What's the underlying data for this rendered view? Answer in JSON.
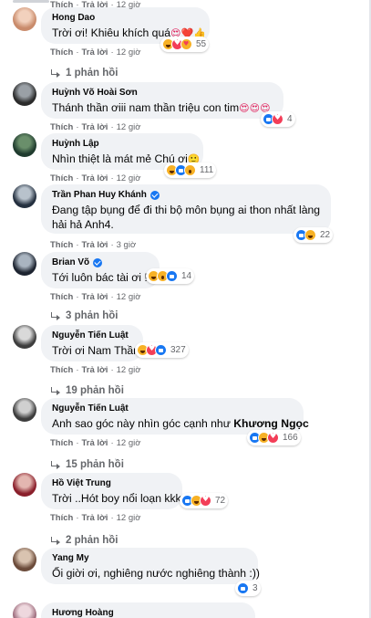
{
  "colors": {
    "bubble_bg": "#f0f2f5",
    "secondary_text": "#65676b",
    "verified_blue": "#1877f2",
    "love_red": "#f33e58",
    "haha_yellow": "#f7b125"
  },
  "action_labels": {
    "like": "Thích",
    "reply": "Trả lời",
    "separator": "·"
  },
  "comments": [
    {
      "author": "Hong Dao",
      "verified": false,
      "text": "Trời ơi! Khiêu khích quá",
      "emoji_suffix": "😍❤️👍",
      "time": "12 giờ",
      "reactions": [
        "haha",
        "love",
        "care"
      ],
      "reaction_count": "55",
      "replies": "1 phản hồi"
    },
    {
      "author": "Huỳnh Võ Hoài Sơn",
      "verified": false,
      "text": "Thánh thần ơiii nam thần triệu con tim",
      "emoji_suffix": "😍😍😍",
      "time": "12 giờ",
      "reactions": [
        "like",
        "love"
      ],
      "reaction_count": "4",
      "replies": ""
    },
    {
      "author": "Huỳnh Lập",
      "verified": false,
      "text": "Nhìn thiệt là mát mẻ Chú ơi",
      "emoji_suffix": "🙂",
      "time": "12 giờ",
      "reactions": [
        "haha",
        "like",
        "wow"
      ],
      "reaction_count": "111",
      "replies": ""
    },
    {
      "author": "Trần Phan Huy Khánh",
      "verified": true,
      "text": "Đang tập bụng để đi thi bộ môn bụng ai thon nhất làng",
      "text_line2": "hải hả Anh4.",
      "emoji_suffix": "",
      "time": "3 giờ",
      "reactions": [
        "like",
        "haha"
      ],
      "reaction_count": "22",
      "replies": ""
    },
    {
      "author": "Brian Võ",
      "verified": true,
      "text": "Tới luôn bác tài ơi !",
      "emoji_suffix": "",
      "time": "12 giờ",
      "reactions": [
        "haha",
        "wow",
        "like"
      ],
      "reaction_count": "14",
      "replies": "3 phản hồi"
    },
    {
      "author": "Nguyễn Tiến Luật",
      "verified": false,
      "text": "Trời ơi Nam Thần",
      "emoji_suffix": "",
      "time": "12 giờ",
      "reactions": [
        "haha",
        "love",
        "like"
      ],
      "reaction_count": "327",
      "replies": "19 phản hồi"
    },
    {
      "author": "Nguyễn Tiến Luật",
      "verified": false,
      "text": "Anh sao góc này nhìn góc cạnh như",
      "tag": "Khương Ngọc",
      "emoji_suffix": "",
      "time": "12 giờ",
      "reactions": [
        "like",
        "haha",
        "love"
      ],
      "reaction_count": "166",
      "replies": "15 phản hồi"
    },
    {
      "author": "Hồ Việt Trung",
      "verified": false,
      "text": "Trời ..Hót boy nổi loạn kkk",
      "emoji_suffix": "",
      "time": "12 giờ",
      "reactions": [
        "like",
        "haha",
        "love"
      ],
      "reaction_count": "72",
      "replies": "2 phản hồi"
    },
    {
      "author": "Yang My",
      "verified": false,
      "text": "Ối giời ơi, nghiêng nước nghiêng thành :))",
      "emoji_suffix": "",
      "time": "12 giờ",
      "reactions": [
        "like"
      ],
      "reaction_count": "3",
      "replies": ""
    },
    {
      "author": "Hương Hoàng",
      "verified": false,
      "text": "",
      "emoji_suffix": "",
      "time": "",
      "reactions": [],
      "reaction_count": "",
      "replies": ""
    }
  ]
}
